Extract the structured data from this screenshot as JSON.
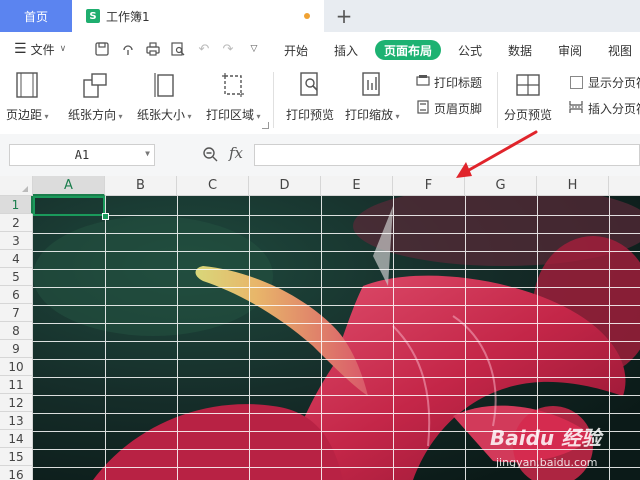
{
  "tabs": {
    "home": "首页",
    "document": "工作簿1"
  },
  "menu": {
    "file": "文件",
    "tabs": [
      "开始",
      "插入",
      "页面布局",
      "公式",
      "数据",
      "审阅",
      "视图"
    ]
  },
  "ribbon": {
    "margins": "页边距",
    "orientation": "纸张方向",
    "size": "纸张大小",
    "print_area": "打印区域",
    "print_preview": "打印预览",
    "print_scale": "打印缩放",
    "print_titles": "打印标题",
    "header_footer": "页眉页脚",
    "page_break_preview": "分页预览",
    "show_page_breaks": "显示分页符",
    "insert_page_break": "插入分页符"
  },
  "formula_bar": {
    "cell_ref": "A1",
    "fx": "fx",
    "formula": ""
  },
  "grid": {
    "columns": [
      "A",
      "B",
      "C",
      "D",
      "E",
      "F",
      "G",
      "H"
    ],
    "rows": [
      "1",
      "2",
      "3",
      "4",
      "5",
      "6",
      "7",
      "8",
      "9",
      "10",
      "11",
      "12",
      "13",
      "14",
      "15",
      "16"
    ],
    "selected_cell": "A1"
  },
  "watermark": {
    "main": "Baidu 经验",
    "sub": "jingyan.baidu.com"
  },
  "colors": {
    "accent_green": "#1db272",
    "home_tab_blue": "#5b84f0",
    "arrow_red": "#e0242b"
  }
}
